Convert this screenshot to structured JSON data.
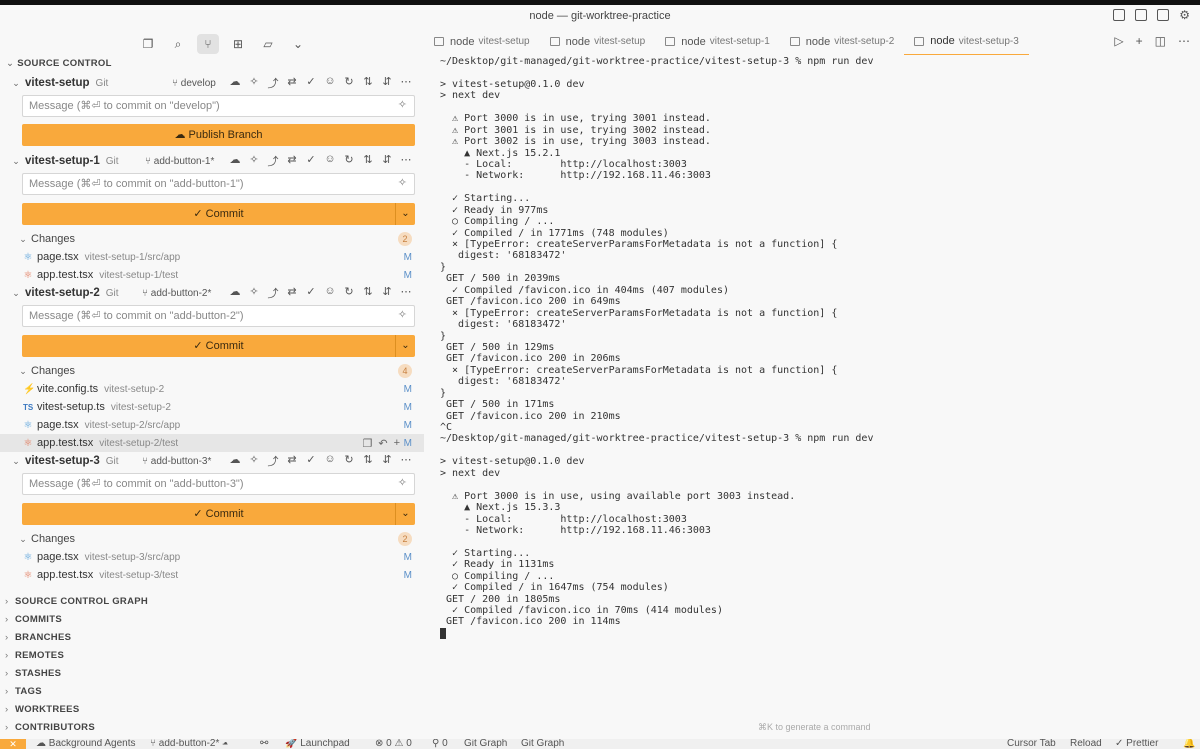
{
  "window_title": "node — git-worktree-practice",
  "sidebar": {
    "section_title": "SOURCE CONTROL",
    "repos": [
      {
        "name": "vitest-setup",
        "type": "Git",
        "branch": "develop",
        "placeholder": "Message (⌘⏎ to commit on \"develop\")",
        "button": "Publish Branch",
        "changes_label": "",
        "changes_count": "",
        "files": []
      },
      {
        "name": "vitest-setup-1",
        "type": "Git",
        "branch": "add-button-1*",
        "placeholder": "Message (⌘⏎ to commit on \"add-button-1\")",
        "button": "✓ Commit",
        "changes_label": "Changes",
        "changes_count": "2",
        "files": [
          {
            "name": "page.tsx",
            "path": "vitest-setup-1/src/app",
            "status": "M",
            "icon": "react-icon"
          },
          {
            "name": "app.test.tsx",
            "path": "vitest-setup-1/test",
            "status": "M",
            "icon": "test-icon"
          }
        ]
      },
      {
        "name": "vitest-setup-2",
        "type": "Git",
        "branch": "add-button-2*",
        "placeholder": "Message (⌘⏎ to commit on \"add-button-2\")",
        "button": "✓ Commit",
        "changes_label": "Changes",
        "changes_count": "4",
        "files": [
          {
            "name": "vite.config.ts",
            "path": "vitest-setup-2",
            "status": "M",
            "icon": "vite-icon"
          },
          {
            "name": "vitest-setup.ts",
            "path": "vitest-setup-2",
            "status": "M",
            "icon": "ts-icon"
          },
          {
            "name": "page.tsx",
            "path": "vitest-setup-2/src/app",
            "status": "M",
            "icon": "react-icon"
          },
          {
            "name": "app.test.tsx",
            "path": "vitest-setup-2/test",
            "status": "M",
            "icon": "test-icon"
          }
        ]
      },
      {
        "name": "vitest-setup-3",
        "type": "Git",
        "branch": "add-button-3*",
        "placeholder": "Message (⌘⏎ to commit on \"add-button-3\")",
        "button": "✓ Commit",
        "changes_label": "Changes",
        "changes_count": "2",
        "files": [
          {
            "name": "page.tsx",
            "path": "vitest-setup-3/src/app",
            "status": "M",
            "icon": "react-icon"
          },
          {
            "name": "app.test.tsx",
            "path": "vitest-setup-3/test",
            "status": "M",
            "icon": "test-icon"
          }
        ]
      }
    ],
    "sections": [
      "SOURCE CONTROL GRAPH",
      "COMMITS",
      "BRANCHES",
      "REMOTES",
      "STASHES",
      "TAGS",
      "WORKTREES",
      "CONTRIBUTORS"
    ]
  },
  "terminal": {
    "tabs": [
      {
        "label": "node",
        "sub": "vitest-setup"
      },
      {
        "label": "node",
        "sub": "vitest-setup"
      },
      {
        "label": "node",
        "sub": "vitest-setup-1"
      },
      {
        "label": "node",
        "sub": "vitest-setup-2"
      },
      {
        "label": "node",
        "sub": "vitest-setup-3"
      }
    ],
    "hint": "⌘K to generate a command",
    "lines": [
      "~/Desktop/git-managed/git-worktree-practice/vitest-setup-3 % npm run dev",
      "",
      "> vitest-setup@0.1.0 dev",
      "> next dev",
      "",
      "  ⚠ Port 3000 is in use, trying 3001 instead.",
      "  ⚠ Port 3001 is in use, trying 3002 instead.",
      "  ⚠ Port 3002 is in use, trying 3003 instead.",
      "    ▲ Next.js 15.2.1",
      "    - Local:        http://localhost:3003",
      "    - Network:      http://192.168.11.46:3003",
      "",
      "  ✓ Starting...",
      "  ✓ Ready in 977ms",
      "  ○ Compiling / ...",
      "  ✓ Compiled / in 1771ms (748 modules)",
      "  ⨯ [TypeError: createServerParamsForMetadata is not a function] {",
      "   digest: '68183472'",
      "}",
      " GET / 500 in 2039ms",
      "  ✓ Compiled /favicon.ico in 404ms (407 modules)",
      " GET /favicon.ico 200 in 649ms",
      "  ⨯ [TypeError: createServerParamsForMetadata is not a function] {",
      "   digest: '68183472'",
      "}",
      " GET / 500 in 129ms",
      " GET /favicon.ico 200 in 206ms",
      "  ⨯ [TypeError: createServerParamsForMetadata is not a function] {",
      "   digest: '68183472'",
      "}",
      " GET / 500 in 171ms",
      " GET /favicon.ico 200 in 210ms",
      "^C",
      "~/Desktop/git-managed/git-worktree-practice/vitest-setup-3 % npm run dev",
      "",
      "> vitest-setup@0.1.0 dev",
      "> next dev",
      "",
      "  ⚠ Port 3000 is in use, using available port 3003 instead.",
      "    ▲ Next.js 15.3.3",
      "    - Local:        http://localhost:3003",
      "    - Network:      http://192.168.11.46:3003",
      "",
      "  ✓ Starting...",
      "  ✓ Ready in 1131ms",
      "  ○ Compiling / ...",
      "  ✓ Compiled / in 1647ms (754 modules)",
      " GET / 200 in 1805ms",
      "  ✓ Compiled /favicon.ico in 70ms (414 modules)",
      " GET /favicon.ico 200 in 114ms"
    ]
  },
  "statusbar": {
    "background_agents": "Background Agents",
    "branch": "add-button-2*",
    "launchpad": "Launchpad",
    "errors": "0",
    "warnings": "0",
    "ports": "0",
    "git_graph_1": "Git Graph",
    "git_graph_2": "Git Graph",
    "cursor_tab": "Cursor Tab",
    "reload": "Reload",
    "prettier": "Prettier"
  },
  "colors": {
    "accent": "#f9a93c",
    "modified": "#5a8fc8",
    "badge_bg": "#f6dcc0"
  }
}
